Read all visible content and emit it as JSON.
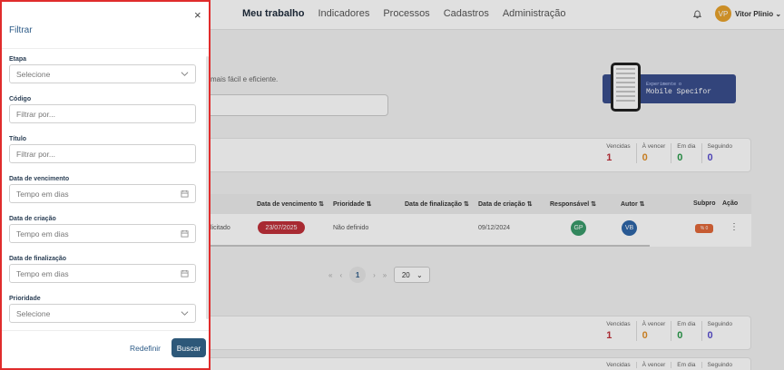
{
  "topbar": {
    "nav": [
      "Meu trabalho",
      "Indicadores",
      "Processos",
      "Cadastros",
      "Administração"
    ],
    "avatar_initials": "VP",
    "user_name": "Vitor Plinio"
  },
  "background": {
    "subtitle": "mais fácil e eficiente.",
    "promo_small": "Experimente o",
    "promo_big": "Mobile Specifor"
  },
  "stats": [
    {
      "label": "Vencidas",
      "value": "1",
      "color": "#c0303a"
    },
    {
      "label": "À vencer",
      "value": "0",
      "color": "#e2902a"
    },
    {
      "label": "Em dia",
      "value": "0",
      "color": "#2a9a4a"
    },
    {
      "label": "Seguindo",
      "value": "0",
      "color": "#5a4fcf"
    }
  ],
  "table": {
    "headers": [
      "Data de vencimento",
      "Prioridade",
      "Data de finalização",
      "Data de criação",
      "Responsável",
      "Autor",
      "Subpro",
      "Ação"
    ],
    "row": {
      "partial": "licitado",
      "due": "23/07/2025",
      "priority": "Não definido",
      "created": "09/12/2024",
      "responsavel": "GP",
      "autor": "VB",
      "subpro": "% 0"
    }
  },
  "pager": {
    "first": "«",
    "prev": "‹",
    "page": "1",
    "next": "›",
    "last": "»",
    "per_page": "20"
  },
  "filter": {
    "title": "Filtrar",
    "close": "×",
    "fields": [
      {
        "label": "Etapa",
        "value": "Selecione",
        "kind": "select"
      },
      {
        "label": "Código",
        "value": "Filtrar por...",
        "kind": "text"
      },
      {
        "label": "Título",
        "value": "Filtrar por...",
        "kind": "text"
      },
      {
        "label": "Data de vencimento",
        "value": "Tempo em dias",
        "kind": "days"
      },
      {
        "label": "Data de criação",
        "value": "Tempo em dias",
        "kind": "days"
      },
      {
        "label": "Data de finalização",
        "value": "Tempo em dias",
        "kind": "days"
      },
      {
        "label": "Prioridade",
        "value": "Selecione",
        "kind": "select"
      }
    ],
    "reset_label": "Redefinir",
    "search_label": "Buscar"
  },
  "colors": {
    "accent": "#2d5879",
    "highlight_border": "#e02c2c"
  }
}
